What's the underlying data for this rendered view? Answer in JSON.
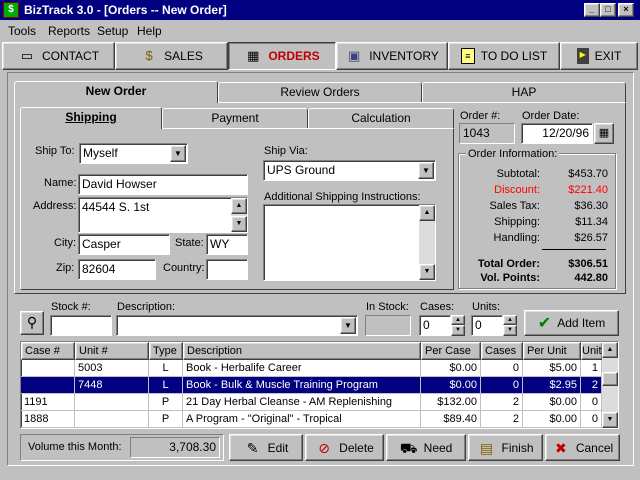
{
  "window": {
    "title": "BizTrack 3.0 - [Orders -- New Order]",
    "app_icon": "biztrack-logo-icon"
  },
  "menu": [
    "Tools",
    "Reports",
    "Setup",
    "Help"
  ],
  "toolbar": [
    {
      "label": "CONTACT",
      "icon": "card-icon"
    },
    {
      "label": "SALES",
      "icon": "money-bag-icon"
    },
    {
      "label": "ORDERS",
      "icon": "cash-register-icon",
      "active": true
    },
    {
      "label": "INVENTORY",
      "icon": "box-icon"
    },
    {
      "label": "TO DO LIST",
      "icon": "note-icon"
    },
    {
      "label": "EXIT",
      "icon": "door-icon"
    }
  ],
  "main_tabs": [
    "New Order",
    "Review Orders",
    "HAP"
  ],
  "sub_tabs": [
    "Shipping",
    "Payment",
    "Calculation"
  ],
  "shipping": {
    "ship_to_label": "Ship To:",
    "ship_to": "Myself",
    "name_label": "Name:",
    "name": "David Howser",
    "address_label": "Address:",
    "address": "44544 S. 1st",
    "city_label": "City:",
    "city": "Casper",
    "state_label": "State:",
    "state": "WY",
    "zip_label": "Zip:",
    "zip": "82604",
    "country_label": "Country:",
    "country": "",
    "ship_via_label": "Ship Via:",
    "ship_via": "UPS Ground",
    "instructions_label": "Additional Shipping Instructions:"
  },
  "order": {
    "number_label": "Order #:",
    "number": "1043",
    "date_label": "Order Date:",
    "date": "12/20/96"
  },
  "order_info": {
    "title": "Order Information:",
    "subtotal_label": "Subtotal:",
    "subtotal": "$453.70",
    "discount_label": "Discount:",
    "discount": "$221.40",
    "sales_tax_label": "Sales Tax:",
    "sales_tax": "$36.30",
    "shipping_label": "Shipping:",
    "shipping": "$11.34",
    "handling_label": "Handling:",
    "handling": "$26.57",
    "total_label": "Total Order:",
    "total": "$306.51",
    "points_label": "Vol. Points:",
    "points": "442.80",
    "discount_color": "#ff0000"
  },
  "entry": {
    "stock_label": "Stock #:",
    "description_label": "Description:",
    "instock_label": "In Stock:",
    "cases_label": "Cases:",
    "cases": "0",
    "units_label": "Units:",
    "units": "0",
    "add_item": "Add Item"
  },
  "grid": {
    "columns": [
      "Case #",
      "Unit #",
      "Type",
      "Description",
      "Per Case",
      "Cases",
      "Per Unit",
      "Units"
    ],
    "rows": [
      [
        "",
        "5003",
        "L",
        "Book - Herbalife Career",
        "$0.00",
        "0",
        "$5.00",
        "1"
      ],
      [
        "",
        "7448",
        "L",
        "Book - Bulk & Muscle Training Program",
        "$0.00",
        "0",
        "$2.95",
        "2"
      ],
      [
        "1191",
        "",
        "P",
        "21 Day Herbal Cleanse - AM Replenishing",
        "$132.00",
        "2",
        "$0.00",
        "0"
      ],
      [
        "1888",
        "",
        "P",
        "A Program  -  \"Original\" - Tropical",
        "$89.40",
        "2",
        "$0.00",
        "0"
      ]
    ],
    "selected_row": 1
  },
  "footer": {
    "volume_label": "Volume this Month:",
    "volume": "3,708.30",
    "edit": "Edit",
    "delete": "Delete",
    "need": "Need",
    "finish": "Finish",
    "cancel": "Cancel"
  },
  "colors": {
    "title_bar": "#000080",
    "selection": "#000080",
    "active_tab": "#c00000"
  }
}
